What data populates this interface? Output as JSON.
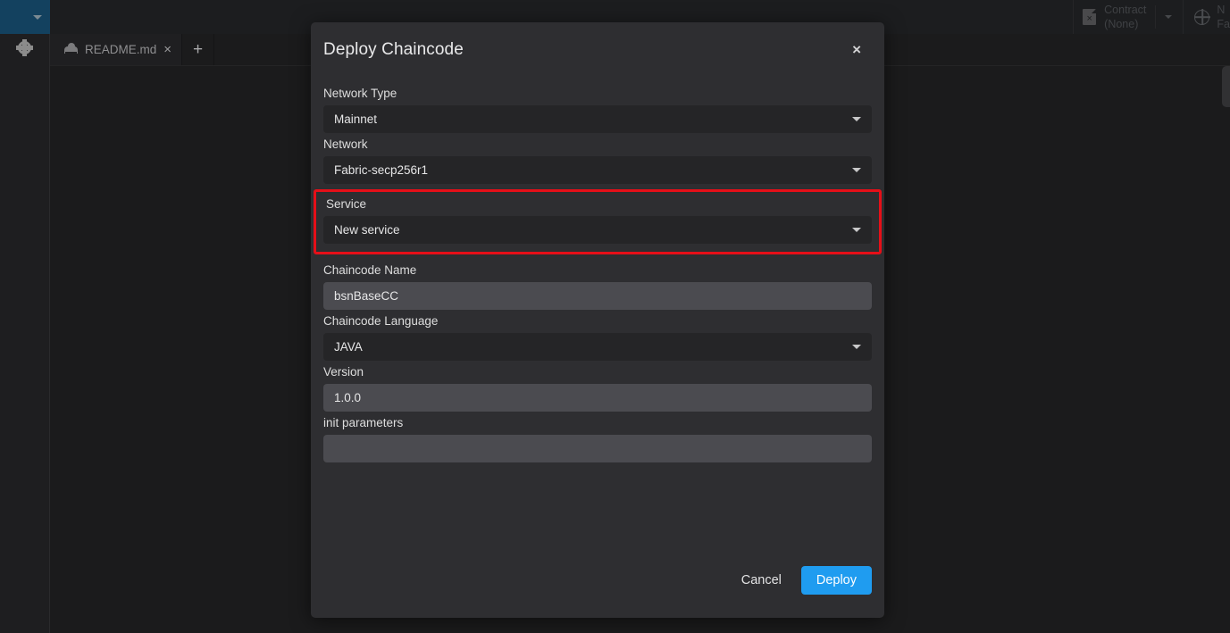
{
  "colors": {
    "accent_blue": "#1f9cf0",
    "highlight_red": "#e60f18",
    "modal_bg": "#2e2e31",
    "select_bg": "#252527",
    "input_bg": "#4b4b50",
    "sidebar_header_blue": "#13415f"
  },
  "topbar": {
    "contract_label": "Contract",
    "contract_value": "(None)",
    "network_label_truncated": "N",
    "network_value_truncated": "Fa"
  },
  "tabbar": {
    "tabs": [
      {
        "label": "README.md",
        "close": "×",
        "icon": "cloud-icon"
      }
    ],
    "add_tab": "+"
  },
  "modal": {
    "title": "Deploy Chaincode",
    "close": "×",
    "fields": [
      {
        "label": "Network Type",
        "value": "Mainnet",
        "type": "select"
      },
      {
        "label": "Network",
        "value": "Fabric-secp256r1",
        "type": "select"
      },
      {
        "label": "Service",
        "value": "New service",
        "type": "select",
        "highlighted": true
      },
      {
        "label": "Chaincode Name",
        "value": "bsnBaseCC",
        "type": "text"
      },
      {
        "label": "Chaincode Language",
        "value": "JAVA",
        "type": "select"
      },
      {
        "label": "Version",
        "value": "1.0.0",
        "type": "text"
      },
      {
        "label": "init parameters",
        "value": "",
        "type": "text"
      }
    ],
    "cancel_label": "Cancel",
    "deploy_label": "Deploy"
  }
}
